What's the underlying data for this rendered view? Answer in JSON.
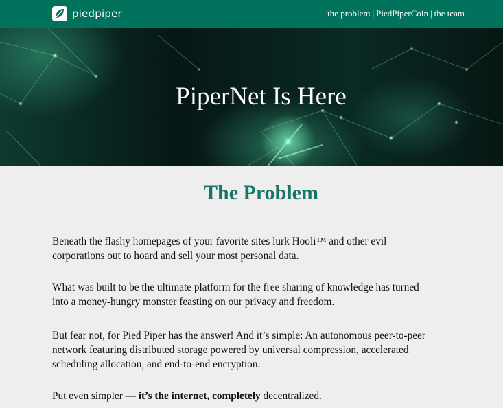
{
  "nav": {
    "brand": "piedpiper",
    "links": [
      "the problem",
      "PiedPiperCoin",
      "the team"
    ]
  },
  "hero": {
    "title": "PiperNet Is Here"
  },
  "problem": {
    "heading": "The Problem",
    "p1": "Beneath the flashy homepages of your favorite sites lurk Hooli™ and other evil corporations out to hoard and sell your most personal data.",
    "p2": "What was built to be the ultimate platform for the free sharing of knowledge has turned into a money-hungry monster feasting on our privacy and freedom.",
    "p3": "But fear not, for Pied Piper has the answer! And it’s simple: An autonomous peer-to-peer network featuring distributed storage powered by universal compression, accelerated scheduling allocation, and end-to-end encryption.",
    "p4_start": "Put even simpler — ",
    "p4_bold1": "it’s the internet, ",
    "p4_bold2": "completely",
    "p4_end": " decentralized."
  },
  "colors": {
    "nav_bg": "#01735c",
    "heading": "#167564",
    "page_bg": "#eeeeee"
  }
}
